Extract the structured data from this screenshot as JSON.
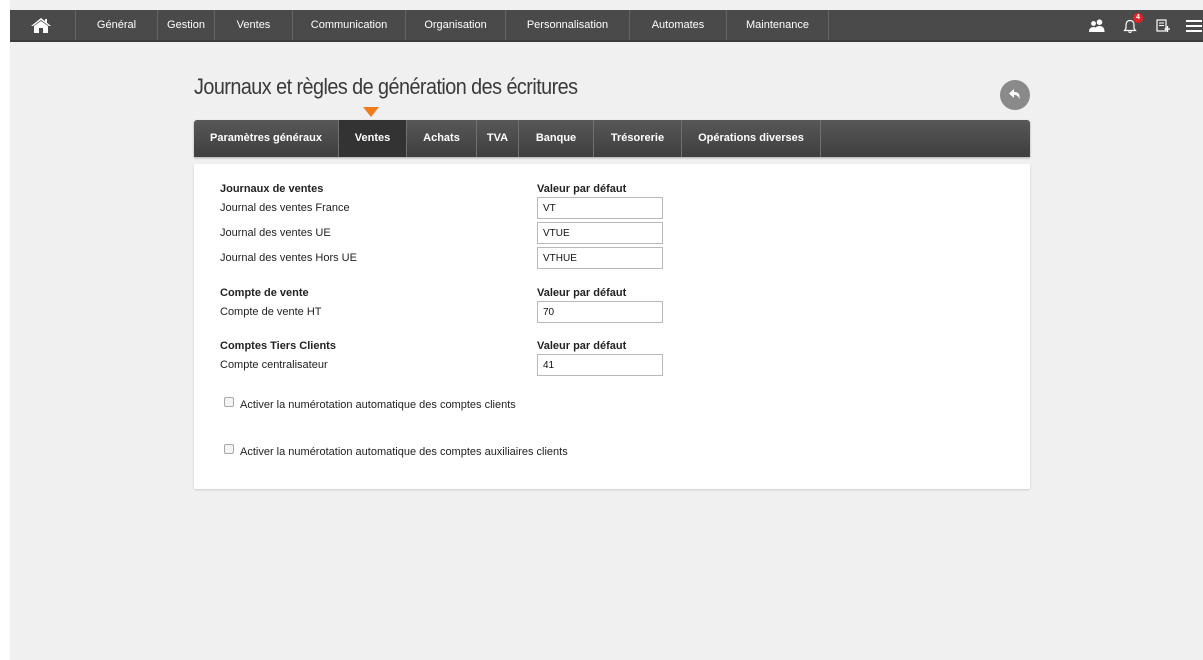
{
  "nav": {
    "items": [
      "Général",
      "Gestion",
      "Ventes",
      "Communication",
      "Organisation",
      "Personnalisation",
      "Automates",
      "Maintenance"
    ],
    "notification_count": "4",
    "icons": [
      "home-icon",
      "users-icon",
      "bell-icon",
      "new-document-icon",
      "hamburger-menu-icon"
    ]
  },
  "page": {
    "title": "Journaux et règles de génération des écritures"
  },
  "tabs": [
    "Paramètres généraux",
    "Ventes",
    "Achats",
    "TVA",
    "Banque",
    "Trésorerie",
    "Opérations diverses"
  ],
  "active_tab": "Ventes",
  "colors": {
    "accent": "#f07b1b",
    "topbar": "#4a4a4a",
    "badge": "#e2242a"
  },
  "form": {
    "sections": [
      {
        "heading": "Journaux de ventes",
        "default_label": "Valeur par défaut",
        "fields": [
          {
            "label": "Journal des ventes France",
            "value": "VT"
          },
          {
            "label": "Journal des ventes UE",
            "value": "VTUE"
          },
          {
            "label": "Journal des ventes Hors UE",
            "value": "VTHUE"
          }
        ]
      },
      {
        "heading": "Compte de vente",
        "default_label": "Valeur par défaut",
        "fields": [
          {
            "label": "Compte de vente HT",
            "value": "70"
          }
        ]
      },
      {
        "heading": "Comptes Tiers Clients",
        "default_label": "Valeur par défaut",
        "fields": [
          {
            "label": "Compte centralisateur",
            "value": "41"
          }
        ]
      }
    ],
    "checkboxes": [
      {
        "label": "Activer la numérotation automatique des comptes clients",
        "checked": false
      },
      {
        "label": "Activer la numérotation automatique des comptes auxiliaires clients",
        "checked": false
      }
    ]
  }
}
